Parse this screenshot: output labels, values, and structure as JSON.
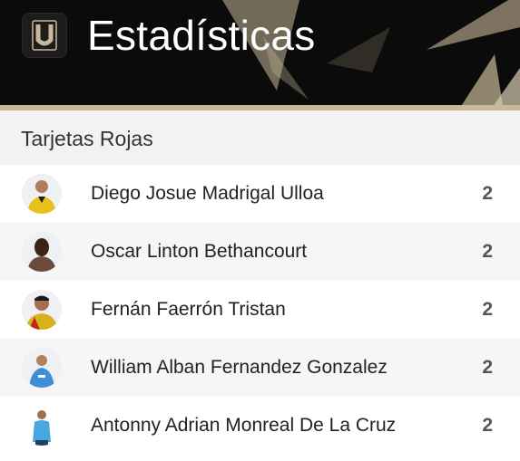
{
  "header": {
    "title": "Estadísticas",
    "logo_letter": "U",
    "colors": {
      "background": "#0b0b0b",
      "accent": "#c9b99a",
      "title": "#ffffff"
    }
  },
  "section": {
    "title": "Tarjetas Rojas"
  },
  "players": [
    {
      "name": "Diego Josue Madrigal Ulloa",
      "count": "2",
      "avatar_icon": "player-photo",
      "kit": "#e8c21a"
    },
    {
      "name": "Oscar Linton Bethancourt",
      "count": "2",
      "avatar_icon": "player-photo",
      "kit": "#6b4a3a"
    },
    {
      "name": "Fernán Faerrón Tristan",
      "count": "2",
      "avatar_icon": "player-photo",
      "kit": "#d8b21a"
    },
    {
      "name": "William Alban Fernandez Gonzalez",
      "count": "2",
      "avatar_icon": "player-photo",
      "kit": "#3f8fd6"
    },
    {
      "name": "Antonny Adrian Monreal De La Cruz",
      "count": "2",
      "avatar_icon": "player-photo",
      "kit": "#47a7de"
    }
  ]
}
